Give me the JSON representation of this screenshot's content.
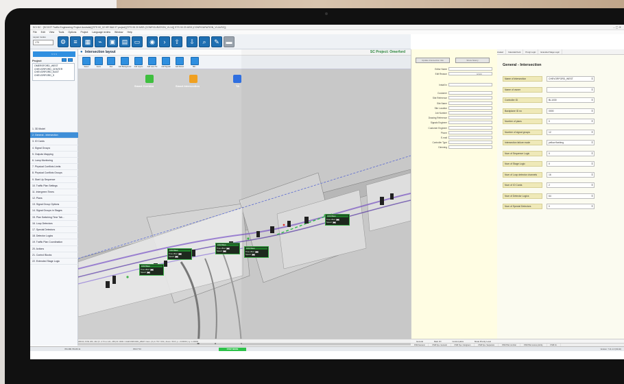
{
  "window": {
    "title": "SCI SC · [SCOOT Traffic Engineering Project Australia] [STS 00_02 HR 5&6 07 project] [STS 05 20 MSS (CONFIGURATION_VL14)] STS 00 23 MSS (CONFIGURATION_VL14/SC)]",
    "controls": "–   ▢   ✕"
  },
  "menu": [
    "File",
    "Edit",
    "View",
    "Tools",
    "Options",
    "Project",
    "Language review",
    "Window",
    "Help"
  ],
  "toolbar": {
    "layout_label": "Layout modes",
    "layout_value": "1T0"
  },
  "left": {
    "tab": "< < <",
    "project_label": "Project",
    "tree": [
      "OMERSFORD_WEST",
      "  CHEVORFORD_CENTER",
      "  CHEVORFORD_EAST",
      "  CHEVORFORD_S"
    ],
    "nav": [
      "1. 3D Model",
      "2. General - Intersection",
      "3. IO Cards",
      "4. Signal Groups",
      "5. Outputs Mapping",
      "6. Lamp Monitoring",
      "7. Physical Conflicts Limits",
      "8. Physical Conflicts Groups",
      "9. Start Up Sequence",
      "10. Traffic Plan Settings",
      "11. Intergreen Times",
      "12. Plans",
      "13. Signal Group Options",
      "14. Signal Groups in Stages",
      "15. Plan Switching Time Tab...",
      "16. Loop Detectors",
      "17. Special Detectors",
      "18. Detector Logics",
      "19. Traffic Plan Coordination",
      "20. Actions",
      "21. Control Blocks",
      "22. Extended Stage Logic"
    ],
    "active_index": 1
  },
  "center": {
    "title": "Intersection layout",
    "project": "SC Project: Omerford",
    "tools": [
      "Select",
      "Zoom",
      "Pan",
      "Add Background",
      "Add Layers",
      "Add Lane Trk",
      "Add Signals",
      "Add Detect",
      "Miri..."
    ],
    "legend": [
      {
        "label": "Smart Corridor",
        "color": "#3fbf3f"
      },
      {
        "label": "Smart Intersection",
        "color": "#f0a020"
      },
      {
        "label": "TA",
        "color": "#2f6fe0"
      }
    ],
    "signal_boxes": [
      {
        "head": "C1M Wave",
        "r1": "Time offset:",
        "r2": "Speed:"
      },
      {
        "head": "C1M Wave",
        "r1": "Time offset:",
        "r2": "Speed:"
      },
      {
        "head": "C1M Wave",
        "r1": "Time offset:",
        "r2": "Speed:"
      },
      {
        "head": "C1M Wave",
        "r1": "Time offset:",
        "r2": "Speed:"
      },
      {
        "head": "C1M Wave",
        "r1": "Time offset:",
        "r2": "Speed:"
      }
    ],
    "coords": "298.03, 8 PE 260, 442     (X: 2.73 LL 141, 265)                         ID: 0000 / CHEVORFORD_WEST                          Cam: (X) 4.779 7.331 | Zoom: 56.8 | p: -0.00009 | xy: 1.00000"
  },
  "tabs": [
    "Configuration",
    "Basic",
    "Groups",
    "Detectors",
    "Inclines",
    "ControlBlocks",
    "TrafficActuated",
    "CalendarClock",
    "Prorgt Logic",
    "Extended Stage Logic"
  ],
  "form": {
    "btn_left": "Update Intersection Info",
    "btn_right": "Show history",
    "rows": [
      "Editor Name",
      "Edit Reason",
      "Install in",
      "Customer",
      "Site Reference",
      "Site Name",
      "Site Location",
      "Job Number",
      "Drawing Reference",
      "Signals Engineer",
      "Customer Engineer",
      "Phone",
      "E-mail",
      "Controller Type",
      "Dimming"
    ],
    "edit_reason_count": "0/100"
  },
  "general": {
    "title": "General - Intersection",
    "rows": [
      {
        "label": "Name of intersection",
        "value": "CHEVORFORD_WEST"
      },
      {
        "label": "Name of owner",
        "value": ""
      },
      {
        "label": "Controller ID",
        "value": "BL1030"
      },
      {
        "label": "Backplane ID no",
        "value": "0000"
      },
      {
        "label": "Number of plans",
        "value": "0"
      },
      {
        "label": "Number of signal groups",
        "value": "12"
      },
      {
        "label": "Intersection failure mode",
        "value": "yellow flashing"
      },
      {
        "label": "Num of Sequence Logic",
        "value": "0"
      },
      {
        "label": "Num of Stage Logic",
        "value": "0"
      },
      {
        "label": "Num of Loop detector channels",
        "value": "16"
      },
      {
        "label": "Num of IO Cards",
        "value": "2"
      },
      {
        "label": "Num of Detector Logics",
        "value": "64"
      },
      {
        "label": "Num of Special Detectors",
        "value": "0"
      }
    ]
  },
  "bottom_tabs": [
    "General",
    "Main I/O",
    "Control plans",
    "Mode Priority Level"
  ],
  "bottom_tabs2": [
    "FSM General",
    "FSM Sys. General",
    "FSM Sys. Intergreen",
    "FSM Sys. Sequence",
    "FSM Plan number",
    "FSM Plan scene priority",
    "FSM Int."
  ],
  "status": {
    "left": "784.389 784.89 41",
    "mid": "PR 07 53",
    "mode": "STOP MODE",
    "right": "Version: 7.11.1.0 (64-bit)"
  }
}
